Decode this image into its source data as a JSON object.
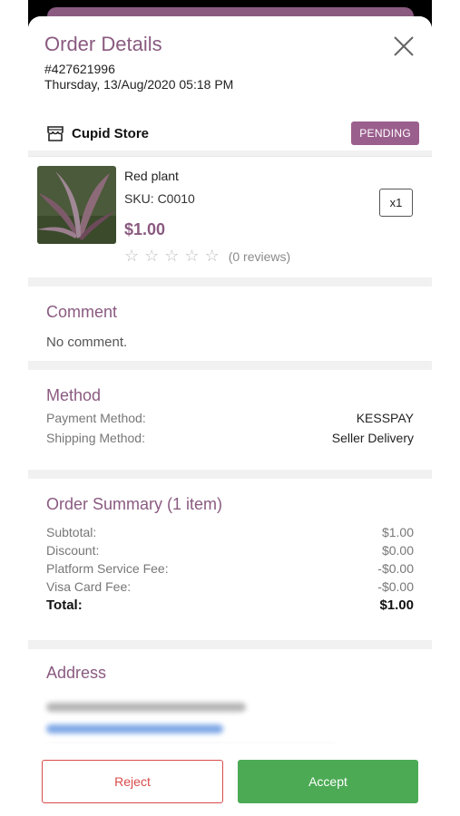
{
  "header": {
    "title": "Order Details",
    "order_id": "#427621996",
    "order_date": "Thursday, 13/Aug/2020 05:18 PM"
  },
  "store": {
    "name": "Cupid Store",
    "status": "PENDING",
    "icon": "store-icon"
  },
  "product": {
    "name": "Red plant",
    "sku": "SKU: C0010",
    "price": "$1.00",
    "rating": 0,
    "reviews": "(0 reviews)",
    "quantity": "x1"
  },
  "comment": {
    "title": "Comment",
    "text": "No comment."
  },
  "method": {
    "title": "Method",
    "payment_label": "Payment Method:",
    "payment_value": "KESSPAY",
    "shipping_label": "Shipping Method:",
    "shipping_value": "Seller Delivery"
  },
  "summary": {
    "title": "Order Summary (1 item)",
    "rows": [
      {
        "label": "Subtotal:",
        "value": "$1.00"
      },
      {
        "label": "Discount:",
        "value": "$0.00"
      },
      {
        "label": "Platform Service Fee:",
        "value": "-$0.00"
      },
      {
        "label": "Visa Card Fee:",
        "value": "-$0.00"
      }
    ],
    "total_label": "Total:",
    "total_value": "$1.00"
  },
  "address": {
    "title": "Address"
  },
  "actions": {
    "reject": "Reject",
    "accept": "Accept"
  },
  "colors": {
    "accent": "#8a5a80",
    "badge": "#9b5f8e",
    "accept": "#4caa55",
    "reject": "#d94b4b"
  }
}
